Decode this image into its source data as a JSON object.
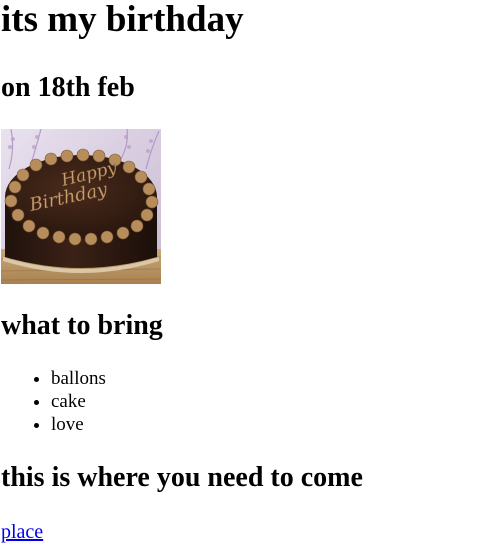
{
  "heading": {
    "title": "its my birthday",
    "date": "on 18th feb"
  },
  "cake_image": {
    "alt": "chocolate cake",
    "icon": "birthday-cake-image",
    "inscription": "Happy Birthday"
  },
  "bring_section": {
    "heading": "what to bring",
    "items": [
      "ballons",
      "cake",
      "love"
    ]
  },
  "where_section": {
    "heading": "this is where you need to come",
    "link_label": "place"
  },
  "colors": {
    "text": "#000000",
    "link": "#0000ee",
    "background": "#ffffff"
  }
}
